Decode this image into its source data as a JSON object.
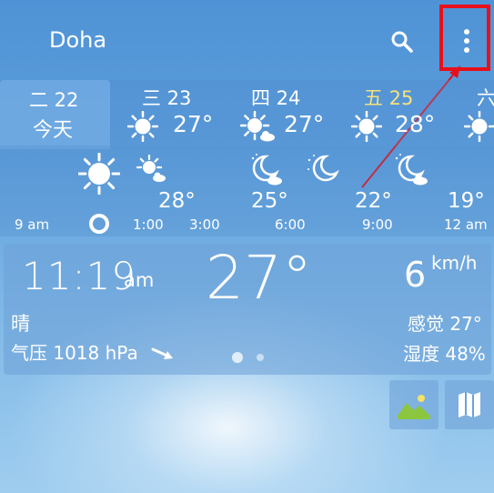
{
  "header": {
    "city": "Doha"
  },
  "days": [
    {
      "date": "二 22",
      "name": "今天",
      "selected": true
    },
    {
      "date": "三 23",
      "temp": "27°"
    },
    {
      "date": "四 24",
      "temp": "27°"
    },
    {
      "date": "五 25",
      "temp": "28°",
      "date_color": "#f6e27c"
    },
    {
      "date": "六"
    }
  ],
  "hourly": {
    "temps": [
      "28°",
      "25°",
      "22°",
      "19°"
    ],
    "times": [
      "9 am",
      "1:00",
      "3:00",
      "6:00",
      "9:00",
      "12 am"
    ]
  },
  "current": {
    "time": "11:19",
    "ampm": "am",
    "temp": "27°",
    "wind": "6",
    "wind_unit": "km/h",
    "condition": "晴",
    "feels": "感觉 27°",
    "pressure": "气压 1018 hPa",
    "humidity": "湿度 48%"
  },
  "colors": {
    "highlight": "#e8101a",
    "sun": "#ffffff"
  },
  "icons": [
    "search-icon",
    "more-vert-icon",
    "sun-icon",
    "moon-cloud-icon",
    "landscape-icon",
    "map-icon",
    "pressure-arrow-icon"
  ]
}
